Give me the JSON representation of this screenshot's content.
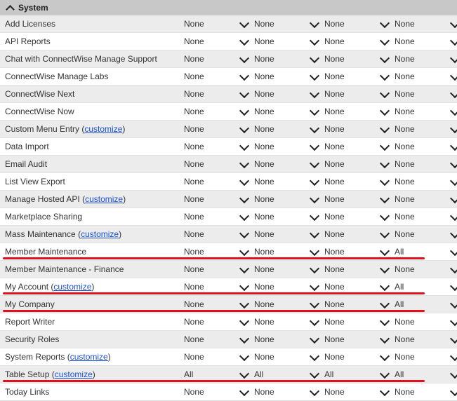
{
  "section": {
    "title": "System"
  },
  "rows": [
    {
      "label": "Add Licenses",
      "customize": "",
      "values": [
        "None",
        "None",
        "None",
        "None"
      ]
    },
    {
      "label": "API Reports",
      "customize": "",
      "values": [
        "None",
        "None",
        "None",
        "None"
      ]
    },
    {
      "label": "Chat with ConnectWise Manage Support",
      "customize": "",
      "values": [
        "None",
        "None",
        "None",
        "None"
      ]
    },
    {
      "label": "ConnectWise Manage Labs",
      "customize": "",
      "values": [
        "None",
        "None",
        "None",
        "None"
      ]
    },
    {
      "label": "ConnectWise Next",
      "customize": "",
      "values": [
        "None",
        "None",
        "None",
        "None"
      ]
    },
    {
      "label": "ConnectWise Now",
      "customize": "",
      "values": [
        "None",
        "None",
        "None",
        "None"
      ]
    },
    {
      "label": "Custom Menu Entry ",
      "customize": "customize",
      "values": [
        "None",
        "None",
        "None",
        "None"
      ]
    },
    {
      "label": "Data Import",
      "customize": "",
      "values": [
        "None",
        "None",
        "None",
        "None"
      ]
    },
    {
      "label": "Email Audit",
      "customize": "",
      "values": [
        "None",
        "None",
        "None",
        "None"
      ]
    },
    {
      "label": "List View Export",
      "customize": "",
      "values": [
        "None",
        "None",
        "None",
        "None"
      ]
    },
    {
      "label": "Manage Hosted API ",
      "customize": "customize",
      "values": [
        "None",
        "None",
        "None",
        "None"
      ]
    },
    {
      "label": "Marketplace Sharing",
      "customize": "",
      "values": [
        "None",
        "None",
        "None",
        "None"
      ]
    },
    {
      "label": "Mass Maintenance ",
      "customize": "customize",
      "values": [
        "None",
        "None",
        "None",
        "None"
      ]
    },
    {
      "label": "Member Maintenance",
      "customize": "",
      "values": [
        "None",
        "None",
        "None",
        "All"
      ],
      "highlight": true
    },
    {
      "label": "Member Maintenance - Finance",
      "customize": "",
      "values": [
        "None",
        "None",
        "None",
        "None"
      ]
    },
    {
      "label": "My Account ",
      "customize": "customize",
      "values": [
        "None",
        "None",
        "None",
        "All"
      ],
      "highlight": true
    },
    {
      "label": "My Company",
      "customize": "",
      "values": [
        "None",
        "None",
        "None",
        "All"
      ],
      "highlight": true
    },
    {
      "label": "Report Writer",
      "customize": "",
      "values": [
        "None",
        "None",
        "None",
        "None"
      ]
    },
    {
      "label": "Security Roles",
      "customize": "",
      "values": [
        "None",
        "None",
        "None",
        "None"
      ]
    },
    {
      "label": "System Reports ",
      "customize": "customize",
      "values": [
        "None",
        "None",
        "None",
        "None"
      ]
    },
    {
      "label": "Table Setup ",
      "customize": "customize",
      "values": [
        "All",
        "All",
        "All",
        "All"
      ],
      "highlight": true
    },
    {
      "label": "Today Links",
      "customize": "",
      "values": [
        "None",
        "None",
        "None",
        "None"
      ]
    }
  ],
  "colors": {
    "highlight_line": "#e0101f",
    "link": "#1a4fd6",
    "header_bg": "#c8c8c8",
    "alt_row": "#ececec"
  }
}
